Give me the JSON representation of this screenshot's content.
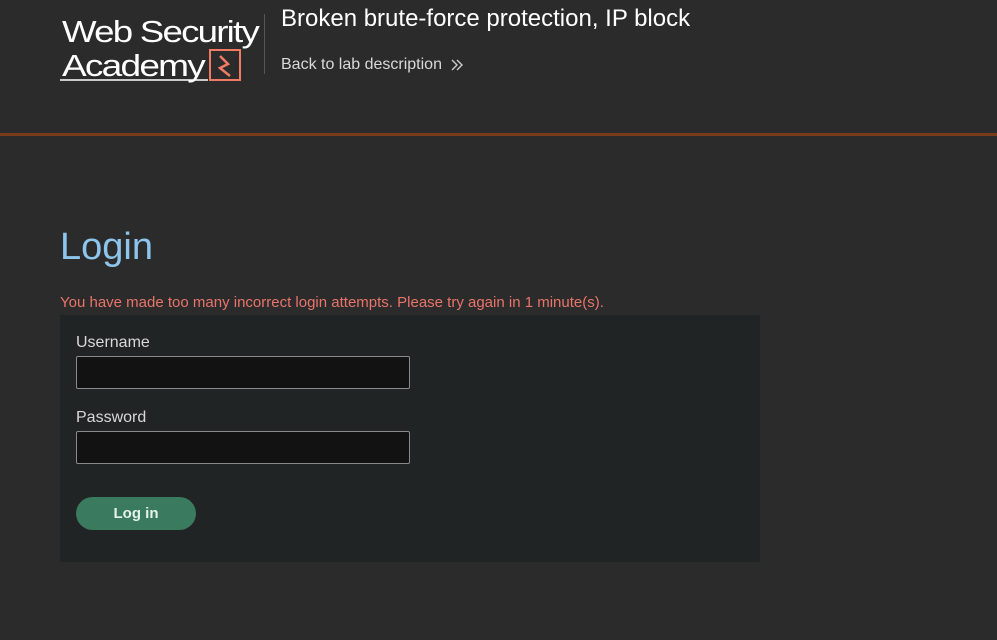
{
  "header": {
    "logo_line1": "Web Security",
    "logo_line2": "Academy",
    "lab_title": "Broken brute-force protection, IP block",
    "back_link_label": "Back to lab description"
  },
  "main": {
    "heading": "Login",
    "error_message": "You have made too many incorrect login attempts. Please try again in 1 minute(s).",
    "username_label": "Username",
    "username_value": "",
    "password_label": "Password",
    "password_value": "",
    "login_button_label": "Log in"
  },
  "colors": {
    "background": "#2b2b2b",
    "accent_rule": "#7a3a1c",
    "heading": "#8ec5ec",
    "error": "#e8746a",
    "button": "#3a7a5e"
  },
  "icons": {
    "logo": "web-security-academy-logo",
    "back_chevron": "double-chevron-right-icon"
  }
}
